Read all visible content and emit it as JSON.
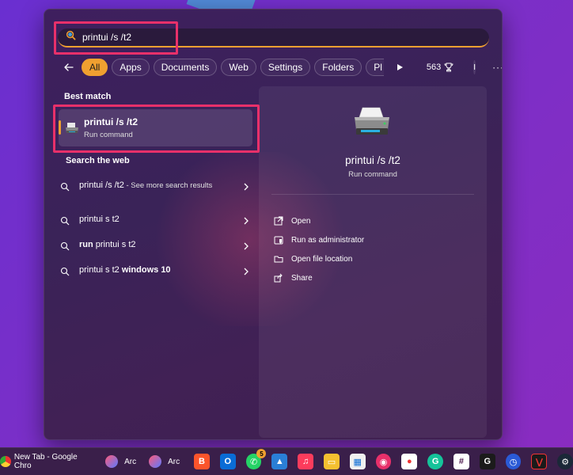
{
  "search": {
    "query": "printui /s /t2"
  },
  "filters": {
    "all": "All",
    "apps": "Apps",
    "documents": "Documents",
    "web": "Web",
    "settings": "Settings",
    "folders": "Folders",
    "pl": "Pl",
    "points": "563",
    "avatar_initial": "I",
    "more": "···"
  },
  "left": {
    "best_match_title": "Best match",
    "best_match": {
      "name": "printui /s /t2",
      "type": "Run command"
    },
    "web_title": "Search the web",
    "web_items": [
      {
        "bold": "printui /s /t2",
        "hint": " - See more search results"
      },
      {
        "plain": "printui s t2"
      },
      {
        "plain_prefix": "run ",
        "bold": "printui s t2"
      },
      {
        "plain": "printui s t2 ",
        "bold_suffix": "windows 10"
      }
    ]
  },
  "preview": {
    "name": "printui /s /t2",
    "type": "Run command",
    "actions": [
      {
        "label": "Open",
        "icon": "open-icon"
      },
      {
        "label": "Run as administrator",
        "icon": "shield-icon"
      },
      {
        "label": "Open file location",
        "icon": "folder-icon"
      },
      {
        "label": "Share",
        "icon": "share-icon"
      }
    ]
  },
  "taskbar": {
    "items": [
      {
        "label": "New Tab - Google Chro",
        "icon": "chrome-icon"
      },
      {
        "label": "Arc",
        "icon": "arc-icon"
      },
      {
        "label": "Arc",
        "icon": "arc-icon"
      },
      {
        "label": "",
        "icon": "brave-icon"
      },
      {
        "label": "",
        "icon": "outlook-icon"
      },
      {
        "label": "",
        "icon": "whatsapp-icon",
        "badge": "5"
      },
      {
        "label": "",
        "icon": "photos-icon"
      },
      {
        "label": "",
        "icon": "music-icon"
      },
      {
        "label": "",
        "icon": "file-explorer-icon"
      },
      {
        "label": "",
        "icon": "store-icon"
      },
      {
        "label": "",
        "icon": "app-icon"
      },
      {
        "label": "",
        "icon": "camera-icon"
      },
      {
        "label": "",
        "icon": "grammarly-icon"
      },
      {
        "label": "",
        "icon": "slack-icon"
      },
      {
        "label": "",
        "icon": "g-hub-icon"
      },
      {
        "label": "",
        "icon": "clock-icon"
      },
      {
        "label": "",
        "icon": "media-icon"
      },
      {
        "label": "",
        "icon": "steam-icon"
      }
    ]
  },
  "colors": {
    "accent": "#f0a030",
    "highlight": "#e8306a"
  }
}
